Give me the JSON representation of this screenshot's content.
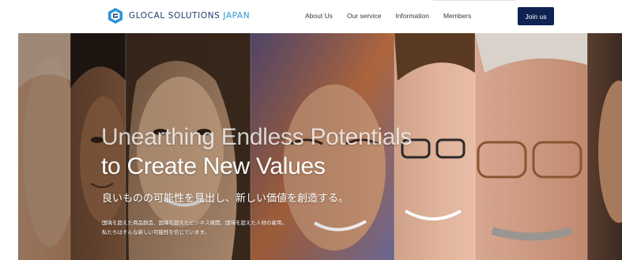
{
  "header": {
    "logo": {
      "text_main": "GLOCAL SOLUTIONS",
      "text_accent": "JAPAN",
      "icon": "glocal-logo-mark"
    },
    "nav": [
      {
        "label": "About Us"
      },
      {
        "label": "Our service"
      },
      {
        "label": "Information"
      },
      {
        "label": "Members"
      }
    ],
    "join_label": "Join us"
  },
  "hero": {
    "headline_line1": "Unearthing Endless Potentials",
    "headline_line2": "to Create New Values",
    "subtitle_jp": "良いものの可能性を見出し、新しい価値を創造する。",
    "body_jp_line1": "国境を超えた商品創造、国境を超えたビジネス展開、国境を超えた人材の雇用。",
    "body_jp_line2": "私たちはそんな新しい可能性を信じています。",
    "photo_description_icons": [
      "face-photo-strip"
    ]
  },
  "colors": {
    "brand_navy": "#0f2353",
    "logo_blue": "#2a96d4",
    "logo_dark": "#1b3c6e"
  }
}
